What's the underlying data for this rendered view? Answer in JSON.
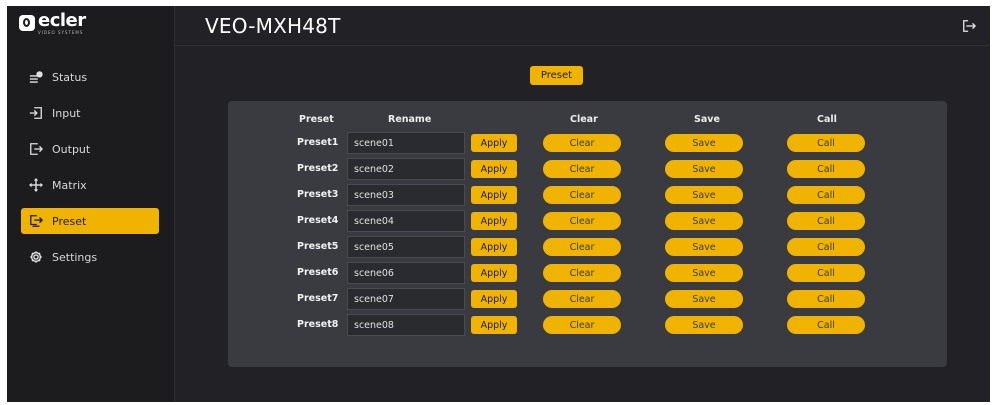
{
  "brand": {
    "name": "ecler",
    "subtitle": "VIDEO SYSTEMS"
  },
  "header": {
    "title": "VEO-MXH48T"
  },
  "sidebar": {
    "items": [
      {
        "label": "Status",
        "icon": "status-icon",
        "active": false
      },
      {
        "label": "Input",
        "icon": "input-icon",
        "active": false
      },
      {
        "label": "Output",
        "icon": "output-icon",
        "active": false
      },
      {
        "label": "Matrix",
        "icon": "matrix-icon",
        "active": false
      },
      {
        "label": "Preset",
        "icon": "preset-icon",
        "active": true
      },
      {
        "label": "Settings",
        "icon": "settings-icon",
        "active": false
      }
    ]
  },
  "main": {
    "tab_label": "Preset",
    "columns": {
      "preset": "Preset",
      "rename": "Rename",
      "clear": "Clear",
      "save": "Save",
      "call": "Call"
    },
    "rows": [
      {
        "preset": "Preset1",
        "name": "scene01",
        "apply": "Apply",
        "clear": "Clear",
        "save": "Save",
        "call": "Call"
      },
      {
        "preset": "Preset2",
        "name": "scene02",
        "apply": "Apply",
        "clear": "Clear",
        "save": "Save",
        "call": "Call"
      },
      {
        "preset": "Preset3",
        "name": "scene03",
        "apply": "Apply",
        "clear": "Clear",
        "save": "Save",
        "call": "Call"
      },
      {
        "preset": "Preset4",
        "name": "scene04",
        "apply": "Apply",
        "clear": "Clear",
        "save": "Save",
        "call": "Call"
      },
      {
        "preset": "Preset5",
        "name": "scene05",
        "apply": "Apply",
        "clear": "Clear",
        "save": "Save",
        "call": "Call"
      },
      {
        "preset": "Preset6",
        "name": "scene06",
        "apply": "Apply",
        "clear": "Clear",
        "save": "Save",
        "call": "Call"
      },
      {
        "preset": "Preset7",
        "name": "scene07",
        "apply": "Apply",
        "clear": "Clear",
        "save": "Save",
        "call": "Call"
      },
      {
        "preset": "Preset8",
        "name": "scene08",
        "apply": "Apply",
        "clear": "Clear",
        "save": "Save",
        "call": "Call"
      }
    ]
  },
  "colors": {
    "accent": "#f0b400",
    "background": "#222226",
    "sidebar": "#1c1c1f",
    "panel": "#3a3b40"
  }
}
